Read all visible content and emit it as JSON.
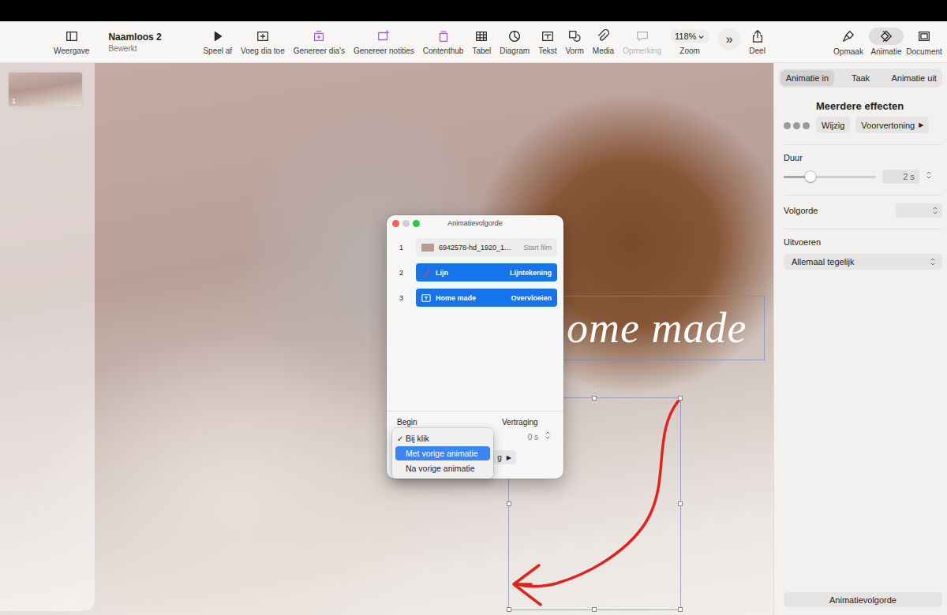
{
  "window": {
    "title": "Naamloos 2",
    "subtitle": "Bewerkt"
  },
  "toolbar": {
    "view": {
      "label": "Weergave"
    },
    "items": [
      {
        "label": "Speel af",
        "kind": "button",
        "color": "#2b2b2b",
        "disabled": false
      },
      {
        "label": "Voeg dia toe",
        "kind": "button",
        "color": "#2b2b2b",
        "disabled": false
      },
      {
        "label": "Genereer dia's",
        "kind": "button",
        "color": "#a35ee0",
        "disabled": false
      },
      {
        "label": "Genereer notities",
        "kind": "button",
        "color": "#a35ee0",
        "disabled": false
      },
      {
        "label": "Contenthub",
        "kind": "button",
        "color": "#a35ee0",
        "disabled": false
      },
      {
        "label": "Tabel",
        "kind": "button",
        "color": "#2b2b2b",
        "disabled": false
      },
      {
        "label": "Diagram",
        "kind": "button",
        "color": "#2b2b2b",
        "disabled": false
      },
      {
        "label": "Tekst",
        "kind": "button",
        "color": "#2b2b2b",
        "disabled": false
      },
      {
        "label": "Vorm",
        "kind": "button",
        "color": "#2b2b2b",
        "disabled": false
      },
      {
        "label": "Media",
        "kind": "button",
        "color": "#2b2b2b",
        "disabled": false
      },
      {
        "label": "Opmerking",
        "kind": "button",
        "color": "#b4b4b4",
        "disabled": true
      },
      {
        "label": "Zoom",
        "kind": "zoom",
        "value": "118%",
        "color": "#2b2b2b",
        "disabled": false
      },
      {
        "label": "»",
        "kind": "overflow",
        "color": "#2b2b2b",
        "disabled": false
      },
      {
        "label": "Deel",
        "kind": "button",
        "color": "#2b2b2b",
        "disabled": false
      }
    ],
    "right": [
      {
        "label": "Opmaak",
        "selected": false
      },
      {
        "label": "Animatie",
        "selected": true
      },
      {
        "label": "Document",
        "selected": false
      }
    ]
  },
  "sidebar": {
    "slides": [
      {
        "number": "1",
        "selected": true
      }
    ]
  },
  "canvas": {
    "text_box": {
      "text": "ome made",
      "selected": true
    },
    "drawing": {
      "selected": true
    }
  },
  "inspector": {
    "tabs": [
      {
        "label": "Animatie in",
        "selected": true
      },
      {
        "label": "Taak",
        "selected": false
      },
      {
        "label": "Animatie uit",
        "selected": false
      }
    ],
    "effect": {
      "title": "Meerdere effecten",
      "edit": "Wijzig",
      "preview": "Voorvertoning",
      "preview_glyph": "▶"
    },
    "duration": {
      "label": "Duur",
      "level": 0.29,
      "value": "2 s",
      "disabled": true
    },
    "order": {
      "label": "Volgorde",
      "disabled": true
    },
    "delivery": {
      "label": "Uitvoeren",
      "value": "Allemaal tegelijk"
    },
    "footer_button": "Animatievolgorde"
  },
  "dialog": {
    "title": "Animatievolgorde",
    "controls": [
      {
        "color": "#ff5f57",
        "disabled": false
      },
      {
        "color": "#cfcfcf",
        "disabled": true
      },
      {
        "color": "#28c840",
        "disabled": false
      }
    ],
    "items": [
      {
        "number": "1",
        "name": "6942578-hd_1920_1…",
        "effect": "Start film",
        "kind": "movie",
        "selected": false
      },
      {
        "number": "2",
        "name": "Lijn",
        "effect": "Lijntekening",
        "kind": "line",
        "selected": true
      },
      {
        "number": "3",
        "name": "Home made",
        "effect": "Overvloeien",
        "kind": "text",
        "selected": true
      }
    ],
    "start": {
      "label": "Begin"
    },
    "delay": {
      "label": "Vertraging",
      "value": "0 s"
    },
    "preview": {
      "label": "g",
      "glyph": "▶"
    }
  },
  "start_menu": {
    "check_glyph": "✓",
    "items": [
      {
        "label": "Bij klik",
        "checked": true,
        "selected": false
      },
      {
        "label": "Met vorige animatie",
        "checked": false,
        "selected": true
      },
      {
        "label": "Na vorige animatie",
        "checked": false,
        "selected": false
      }
    ]
  }
}
